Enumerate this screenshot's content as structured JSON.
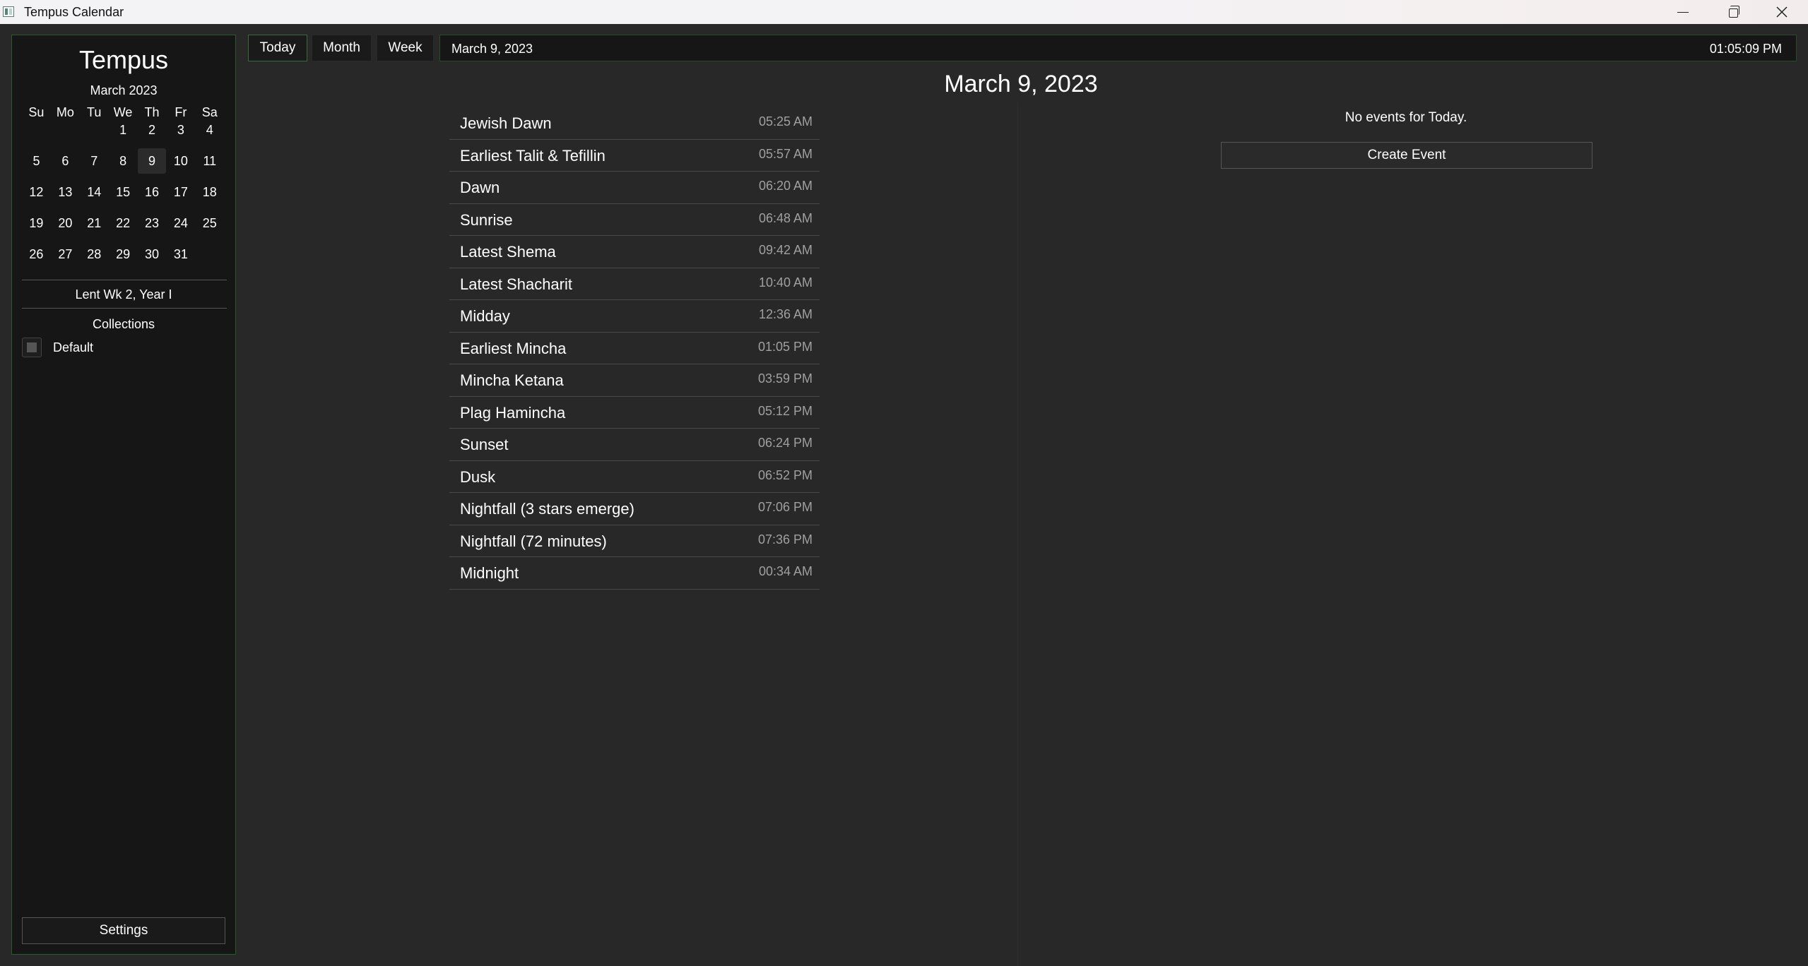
{
  "window": {
    "title": "Tempus Calendar"
  },
  "sidebar": {
    "brand": "Tempus",
    "mini_calendar": {
      "month_label": "March 2023",
      "weekdays": [
        "Su",
        "Mo",
        "Tu",
        "We",
        "Th",
        "Fr",
        "Sa"
      ],
      "weeks": [
        [
          "",
          "",
          "",
          "1",
          "2",
          "3",
          "4"
        ],
        [
          "5",
          "6",
          "7",
          "8",
          "9",
          "10",
          "11"
        ],
        [
          "12",
          "13",
          "14",
          "15",
          "16",
          "17",
          "18"
        ],
        [
          "19",
          "20",
          "21",
          "22",
          "23",
          "24",
          "25"
        ],
        [
          "26",
          "27",
          "28",
          "29",
          "30",
          "31",
          ""
        ]
      ],
      "selected_day": "9"
    },
    "liturgical_label": "Lent Wk 2, Year I",
    "collections_title": "Collections",
    "collections": [
      {
        "label": "Default",
        "checked": true
      }
    ],
    "settings_label": "Settings"
  },
  "toolbar": {
    "today_label": "Today",
    "month_label": "Month",
    "week_label": "Week",
    "current_date": "March 9, 2023",
    "current_time": "01:05:09 PM"
  },
  "main": {
    "date_heading": "March 9, 2023",
    "zmanim": [
      {
        "name": "Jewish Dawn",
        "time": "05:25 AM"
      },
      {
        "name": "Earliest Talit & Tefillin",
        "time": "05:57 AM"
      },
      {
        "name": "Dawn",
        "time": "06:20 AM"
      },
      {
        "name": "Sunrise",
        "time": "06:48 AM"
      },
      {
        "name": "Latest Shema",
        "time": "09:42 AM"
      },
      {
        "name": "Latest Shacharit",
        "time": "10:40 AM"
      },
      {
        "name": "Midday",
        "time": "12:36 AM"
      },
      {
        "name": "Earliest Mincha",
        "time": "01:05 PM"
      },
      {
        "name": "Mincha Ketana",
        "time": "03:59 PM"
      },
      {
        "name": "Plag Hamincha",
        "time": "05:12 PM"
      },
      {
        "name": "Sunset",
        "time": "06:24 PM"
      },
      {
        "name": "Dusk",
        "time": "06:52 PM"
      },
      {
        "name": "Nightfall (3 stars emerge)",
        "time": "07:06 PM"
      },
      {
        "name": "Nightfall (72 minutes)",
        "time": "07:36 PM"
      },
      {
        "name": "Midnight",
        "time": "00:34 AM"
      }
    ],
    "no_events_text": "No events for Today.",
    "create_event_label": "Create Event"
  },
  "icons": {
    "app": "calendar-app-icon",
    "minimize": "minimize-icon",
    "maximize": "restore-icon",
    "close": "close-icon"
  },
  "colors": {
    "background": "#282828",
    "sidebar": "#161616",
    "accent_border": "#2a5a2a",
    "time_text": "#a0a0a0"
  }
}
